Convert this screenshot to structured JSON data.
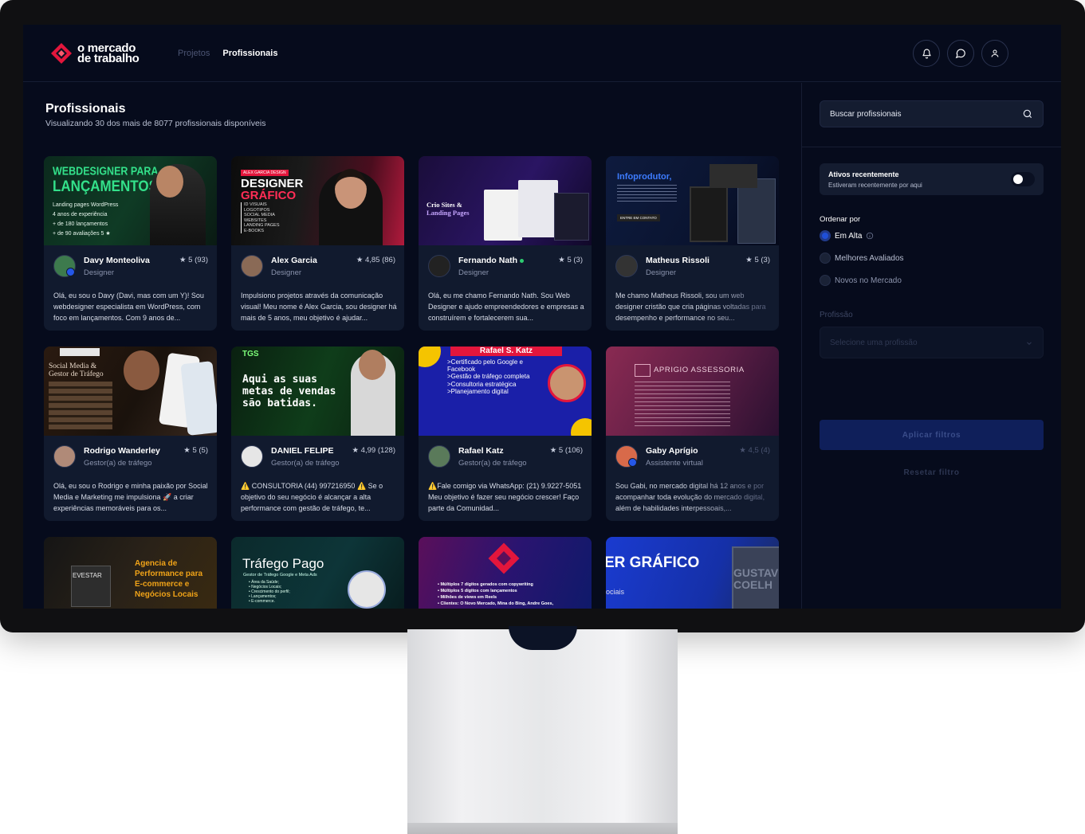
{
  "app": {
    "logo_line1": "o mercado",
    "logo_line2": "de trabalho",
    "brand_color": "#e3163c"
  },
  "nav": [
    {
      "label": "Projetos"
    },
    {
      "label": "Profissionais"
    }
  ],
  "header_icons": [
    "bell-icon",
    "chat-icon",
    "user-icon"
  ],
  "main": {
    "title": "Profissionais",
    "subtitle": "Visualizando 30 dos mais de 8077 profissionais disponíveis"
  },
  "cards": [
    {
      "name": "Davy Monteoliva",
      "role": "Designer",
      "rating": "★ 5 (93)",
      "description": "Olá, eu sou o Davy (Davi, mas com um Y)! Sou webdesigner especialista em WordPress, com foco em lançamentos. Com 9 anos de...",
      "thumb_lines": [
        "WEBDESIGNER PARA",
        "LANÇAMENTOS",
        "Landing pages WordPress",
        "4 anos de experiência",
        "+ de 180 lançamentos",
        "+ de 90 avaliações 5 ★"
      ]
    },
    {
      "name": "Alex Garcia",
      "role": "Designer",
      "rating": "★ 4,85 (86)",
      "description": "Impulsiono projetos através da comunicação visual! Meu nome é Alex Garcia, sou designer há mais de 5 anos, meu objetivo é ajudar...",
      "thumb_lines": [
        "ALEX GARCIA DESIGN",
        "DESIGNER",
        "GRÁFICO",
        "ID VISUAIS",
        "LOGOTIPOS",
        "SOCIAL MEDIA",
        "WEBSITES",
        "LANDING PAGES",
        "E-BOOKS"
      ]
    },
    {
      "name": "Fernando Nath",
      "role": "Designer",
      "rating": "★ 5 (3)",
      "description": "Olá, eu me chamo Fernando Nath. Sou Web Designer e ajudo empreendedores e empresas a construírem e fortalecerem sua...",
      "thumb_lines": [
        "Crio Sites &",
        "Landing Pages"
      ]
    },
    {
      "name": "Matheus Rissoli",
      "role": "Designer",
      "rating": "★ 5 (3)",
      "description": "Me chamo Matheus Rissoli, sou um web designer cristão que cria páginas voltadas para desempenho e performance no seu...",
      "thumb_lines": [
        "Infoprodutor,",
        "ENTRE EM CONTATO"
      ]
    },
    {
      "name": "Rodrigo Wanderley",
      "role": "Gestor(a) de tráfego",
      "rating": "★ 5 (5)",
      "description": "Olá, eu sou o Rodrigo e minha paixão por Social Media e Marketing me impulsiona 🚀 a criar experiências memoráveis para os...",
      "thumb_lines": [
        "Social Media &",
        "Gestor de Tráfego"
      ]
    },
    {
      "name": "DANIEL FELIPE",
      "role": "Gestor(a) de tráfego",
      "rating": "★ 4,99 (128)",
      "description": "⚠️ CONSULTORIA (44) 997216950 ⚠️ Se o objetivo do seu negócio é alcançar a alta performance com gestão de tráfego, te...",
      "thumb_lines": [
        "TGS",
        "Aqui as suas",
        "metas de vendas",
        "são batidas."
      ]
    },
    {
      "name": "Rafael Katz",
      "role": "Gestor(a) de tráfego",
      "rating": "★ 5 (106)",
      "description": "⚠️Fale comigo via WhatsApp: (21) 9.9227-5051 Meu objetivo é fazer seu negócio crescer! Faço parte da Comunidad...",
      "thumb_lines": [
        "Rafael S. Katz",
        ">Certificado pelo Google e",
        "Facebook",
        ">Gestão de tráfego completa",
        ">Consultoria estratégica",
        ">Planejamento digital"
      ]
    },
    {
      "name": "Gaby Aprígio",
      "role": "Assistente virtual",
      "rating": "★ 4,5 (4)",
      "description": "Sou Gabi, no mercado digital há 12 anos e por acompanhar toda evolução do mercado digital, além de habilidades interpessoais,...",
      "thumb_lines": [
        "APRIGIO ASSESSORIA"
      ]
    },
    {
      "name": "",
      "role": "",
      "rating": "",
      "description": "",
      "thumb_lines": [
        "Agencia de",
        "Performance para",
        "E-commerce e",
        "Negócios Locais",
        "EVESTAR"
      ]
    },
    {
      "name": "",
      "role": "",
      "rating": "",
      "description": "",
      "thumb_lines": [
        "Tráfego Pago",
        "Gestor de Tráfego Google e Meta Ads",
        "• Área da Saúde;",
        "• Negócios Locais;",
        "• Crescimento do perfil;",
        "• Lançamentos;",
        "• E-commerce."
      ]
    },
    {
      "name": "",
      "role": "",
      "rating": "",
      "description": "",
      "thumb_lines": [
        "• Múltiplos 7 dígitos gerados com copywriting",
        "• Múltiplos 5 dígitos com lançamentos",
        "• Milhões de views em Reels",
        "• Clientes: O Novo Mercado, Mina do Bing, Andre Goes,"
      ]
    },
    {
      "name": "",
      "role": "",
      "rating": "",
      "description": "",
      "thumb_lines": [
        "ER GRÁFICO",
        "ociais",
        "GUSTAV",
        "COELH"
      ]
    }
  ],
  "sidebar": {
    "search_placeholder": "Buscar profissionais",
    "recent_title": "Ativos recentemente",
    "recent_sub": "Estiveram recentemente por aqui",
    "order_label": "Ordenar por",
    "order_options": [
      {
        "label": "Em Alta",
        "selected": true
      },
      {
        "label": "Melhores Avaliados",
        "selected": false
      },
      {
        "label": "Novos no Mercado",
        "selected": false
      }
    ],
    "profession_label": "Profissão",
    "profession_placeholder": "Selecione uma profissão",
    "apply_label": "Aplicar filtros",
    "reset_label": "Resetar filtro"
  }
}
